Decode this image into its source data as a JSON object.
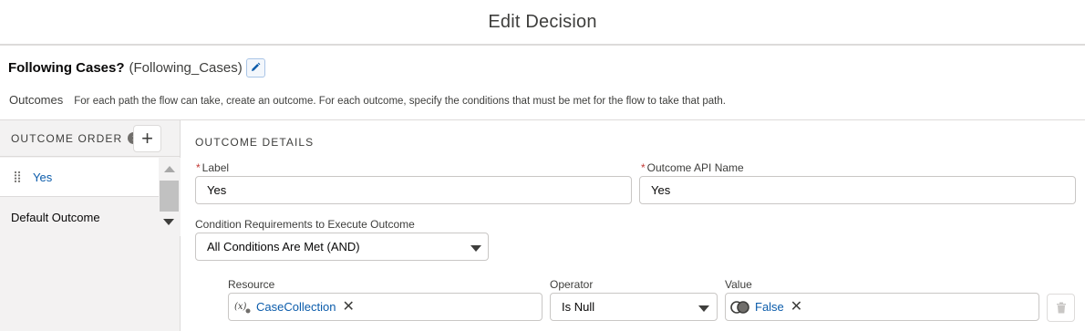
{
  "header": {
    "title": "Edit Decision"
  },
  "element": {
    "name": "Following Cases?",
    "api_name": "(Following_Cases)"
  },
  "outcomes": {
    "label": "Outcomes",
    "description": "For each path the flow can take, create an outcome. For each outcome, specify the conditions that must be met for the flow to take that path."
  },
  "sidebar": {
    "order_label": "OUTCOME ORDER",
    "add_label": "+",
    "items": [
      {
        "label": "Yes"
      },
      {
        "label": "Default Outcome"
      }
    ]
  },
  "details": {
    "title": "OUTCOME DETAILS",
    "label_field": {
      "label": "Label",
      "required": "*",
      "value": "Yes"
    },
    "api_field": {
      "label": "Outcome API Name",
      "required": "*",
      "value": "Yes"
    },
    "condition_req": {
      "label": "Condition Requirements to Execute Outcome",
      "value": "All Conditions Are Met (AND)"
    },
    "condition": {
      "resource_label": "Resource",
      "resource_value": "CaseCollection",
      "operator_label": "Operator",
      "operator_value": "Is Null",
      "value_label": "Value",
      "value_value": "False"
    }
  },
  "icons": {
    "edit": "pencil-icon",
    "info": "info-icon",
    "drag": "drag-handle-icon",
    "variable": "variable-icon",
    "boolean": "boolean-icon",
    "remove": "close-icon",
    "delete": "trash-icon"
  },
  "colors": {
    "link": "#0b5cab",
    "required": "#c23934",
    "sidebar_bg": "#f3f2f2",
    "border": "#dddbda"
  }
}
